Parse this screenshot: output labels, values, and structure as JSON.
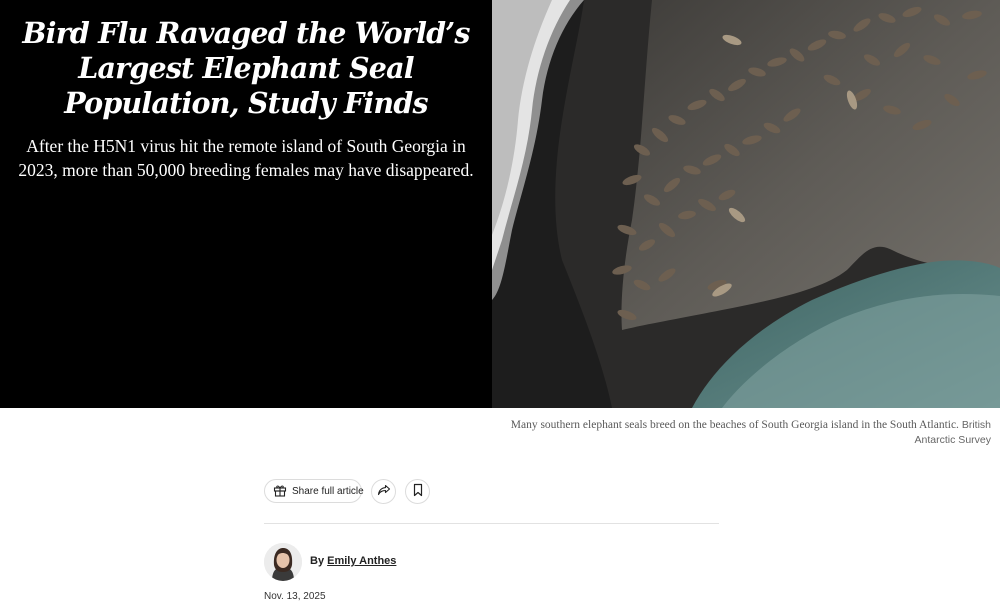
{
  "article": {
    "headline": "Bird Flu Ravaged the World’s Largest Elephant Seal Population, Study Finds",
    "dek": "After the H5N1 virus hit the remote island of South Georgia in 2023, more than 50,000 breeding females may have disappeared.",
    "photo_caption": "Many southern elephant seals breed on the beaches of South Georgia island in the South Atlantic.",
    "photo_credit": "British Antarctic Survey",
    "byline_prefix": "By",
    "author": "Emily Anthes",
    "date": "Nov. 13, 2025"
  },
  "toolbar": {
    "share_full_label": "Share full article",
    "share_icon": "share-arrow-icon",
    "save_icon": "bookmark-icon",
    "gift_icon": "gift-icon"
  },
  "colors": {
    "hero_background": "#000000",
    "headline_text": "#ffffff",
    "caption_text": "#5a5a5a"
  }
}
